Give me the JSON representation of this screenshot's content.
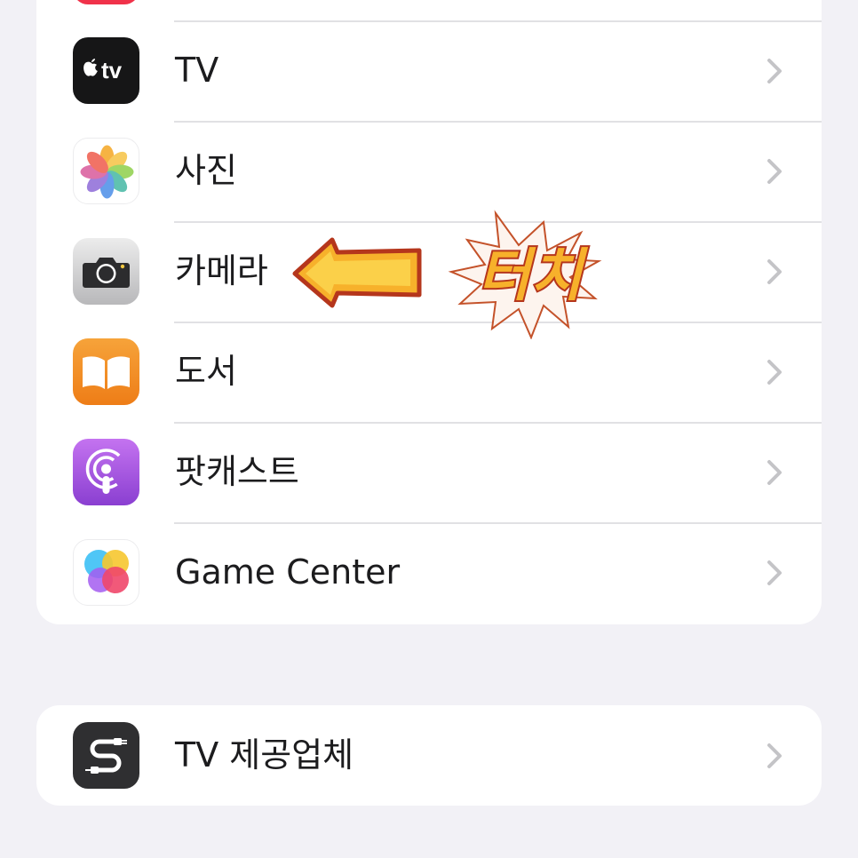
{
  "settings_list": {
    "items": [
      {
        "label": "TV",
        "icon": "apple-tv-icon"
      },
      {
        "label": "사진",
        "icon": "photos-icon"
      },
      {
        "label": "카메라",
        "icon": "camera-icon"
      },
      {
        "label": "도서",
        "icon": "books-icon"
      },
      {
        "label": "팟캐스트",
        "icon": "podcasts-icon"
      },
      {
        "label": "Game Center",
        "icon": "game-center-icon"
      }
    ]
  },
  "provider_section": {
    "items": [
      {
        "label": "TV 제공업체",
        "icon": "tv-provider-icon"
      }
    ]
  },
  "annotation": {
    "text": "터치",
    "icon": "left-arrow-icon"
  },
  "colors": {
    "background": "#f2f1f6",
    "card": "#ffffff",
    "chevron": "#c4c4c7",
    "annotation_fill": "#f7b12b",
    "annotation_outline": "#b5361c"
  }
}
